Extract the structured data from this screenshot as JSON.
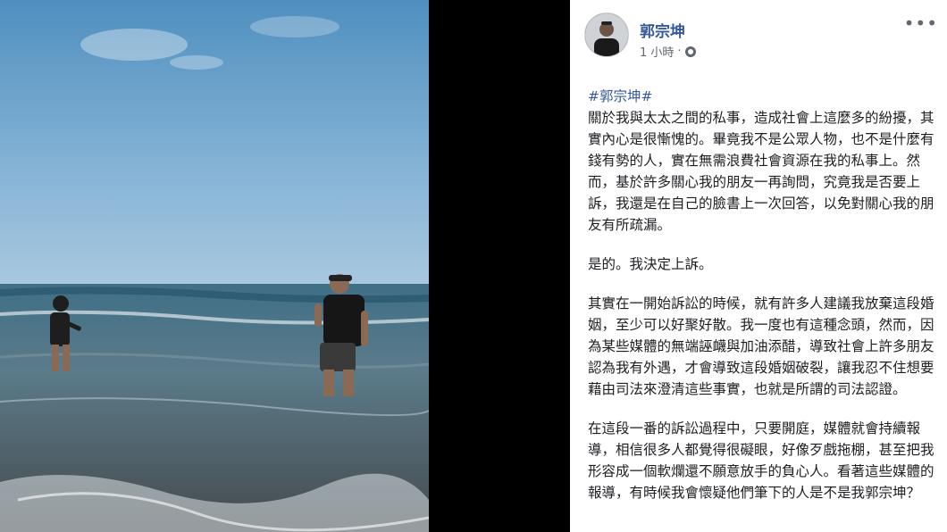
{
  "post": {
    "author": "郭宗坤",
    "time": "1 小時",
    "dot": "·",
    "more": "•••",
    "hashtag": "#郭宗坤#",
    "paragraphs": [
      "關於我與太太之間的私事，造成社會上這麼多的紛擾，其實內心是很慚愧的。畢竟我不是公眾人物，也不是什麼有錢有勢的人，實在無需浪費社會資源在我的私事上。然而，基於許多關心我的朋友一再詢問，究竟我是否要上訴，我還是在自己的臉書上一次回答，以免對關心我的朋友有所疏漏。",
      "是的。我決定上訴。",
      "其實在一開始訴訟的時候，就有許多人建議我放棄這段婚姻，至少可以好聚好散。我一度也有這種念頭，然而，因為某些媒體的無端誣衊與加油添醋，導致社會上許多朋友認為我有外遇，才會導致這段婚姻破裂，讓我忍不住想要藉由司法來澄清這些事實，也就是所謂的司法認證。",
      "在這段一番的訴訟過程中，只要開庭，媒體就會持續報導，相信很多人都覺得很礙眼，好像歹戲拖棚，甚至把我形容成一個軟爛還不願意放手的負心人。看著這些媒體的報導，有時候我會懷疑他們筆下的人是不是我郭宗坤？"
    ]
  },
  "colors": {
    "link": "#365899",
    "text": "#1c1e21",
    "meta": "#616770"
  }
}
